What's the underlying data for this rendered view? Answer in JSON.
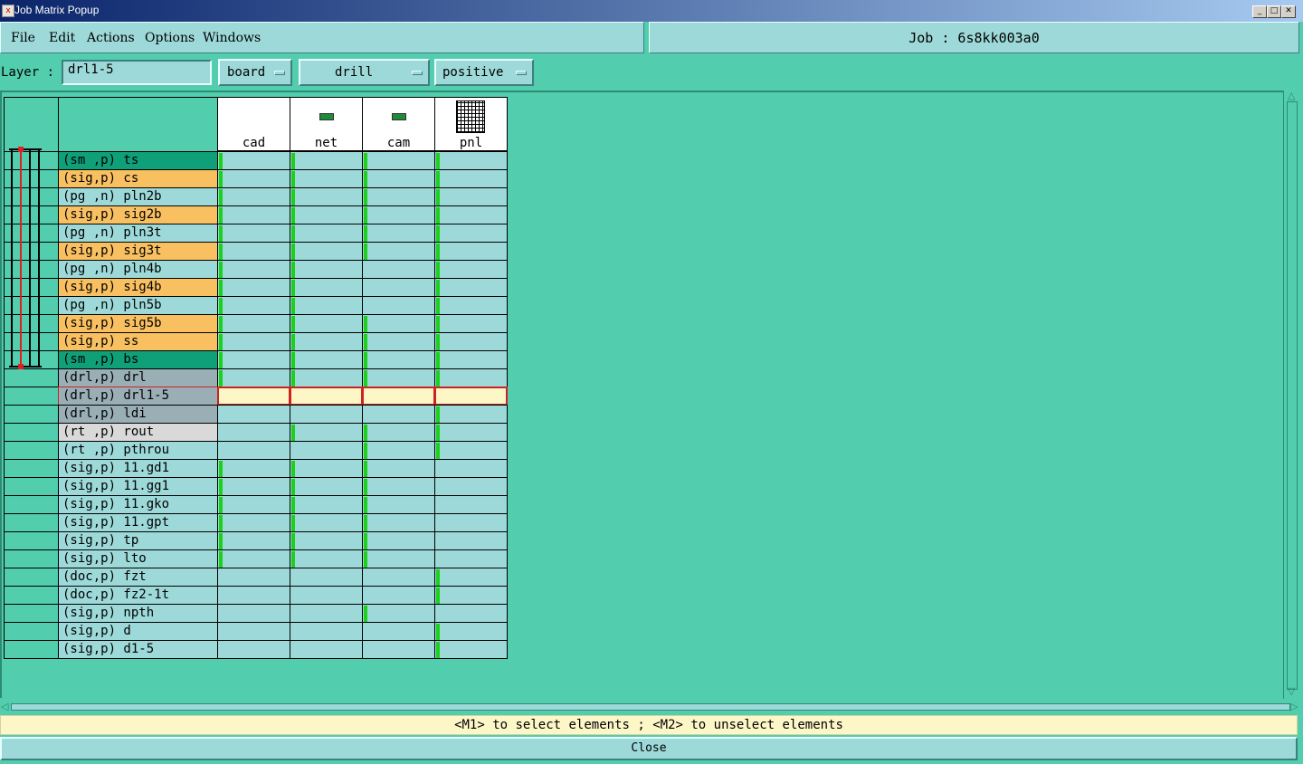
{
  "window": {
    "title": "Job Matrix Popup"
  },
  "menu": {
    "items": [
      "File",
      "Edit",
      "Actions",
      "Options",
      "Windows"
    ]
  },
  "job": {
    "label": "Job : 6s8kk003a0"
  },
  "layer_bar": {
    "label": "Layer :",
    "value": "drl1-5",
    "context": "board",
    "type": "drill",
    "polarity": "positive"
  },
  "matrix": {
    "columns": [
      {
        "name": "cad",
        "icon": "blank"
      },
      {
        "name": "net",
        "icon": "board-thumbnail-icon"
      },
      {
        "name": "cam",
        "icon": "board-thumbnail-icon"
      },
      {
        "name": "pnl",
        "icon": "panel-thumbnail-icon"
      }
    ],
    "rows": [
      {
        "label": "(sm ,p) ts",
        "color": "#0fa079",
        "exists": [
          1,
          1,
          1,
          1
        ]
      },
      {
        "label": "(sig,p) cs",
        "color": "#f8c061",
        "exists": [
          1,
          1,
          1,
          1
        ]
      },
      {
        "label": "(pg ,n) pln2b",
        "color": "#9ed9d9",
        "exists": [
          1,
          1,
          1,
          1
        ]
      },
      {
        "label": "(sig,p) sig2b",
        "color": "#f8c061",
        "exists": [
          1,
          1,
          1,
          1
        ]
      },
      {
        "label": "(pg ,n) pln3t",
        "color": "#9ed9d9",
        "exists": [
          1,
          1,
          1,
          1
        ]
      },
      {
        "label": "(sig,p) sig3t",
        "color": "#f8c061",
        "exists": [
          1,
          1,
          1,
          1
        ]
      },
      {
        "label": "(pg ,n) pln4b",
        "color": "#9ed9d9",
        "exists": [
          1,
          1,
          0,
          1
        ]
      },
      {
        "label": "(sig,p) sig4b",
        "color": "#f8c061",
        "exists": [
          1,
          1,
          0,
          1
        ]
      },
      {
        "label": "(pg ,n) pln5b",
        "color": "#9ed9d9",
        "exists": [
          1,
          1,
          0,
          1
        ]
      },
      {
        "label": "(sig,p) sig5b",
        "color": "#f8c061",
        "exists": [
          1,
          1,
          1,
          1
        ]
      },
      {
        "label": "(sig,p) ss",
        "color": "#f8c061",
        "exists": [
          1,
          1,
          1,
          1
        ]
      },
      {
        "label": "(sm ,p) bs",
        "color": "#0fa079",
        "exists": [
          1,
          1,
          1,
          1
        ]
      },
      {
        "label": "(drl,p) drl",
        "color": "#9aaeb6",
        "exists": [
          1,
          1,
          1,
          1
        ]
      },
      {
        "label": "(drl,p) drl1-5",
        "color": "#9aaeb6",
        "exists": [
          0,
          0,
          0,
          0
        ],
        "selected": true
      },
      {
        "label": "(drl,p) ldi",
        "color": "#9aaeb6",
        "exists": [
          0,
          0,
          0,
          1
        ]
      },
      {
        "label": "(rt ,p) rout",
        "color": "#d9d9d9",
        "exists": [
          0,
          1,
          1,
          1
        ]
      },
      {
        "label": "(rt ,p) pthrou",
        "color": "#9ed9d9",
        "exists": [
          0,
          0,
          1,
          1
        ]
      },
      {
        "label": "(sig,p) 11.gd1",
        "color": "#9ed9d9",
        "exists": [
          1,
          1,
          1,
          0
        ]
      },
      {
        "label": "(sig,p) 11.gg1",
        "color": "#9ed9d9",
        "exists": [
          1,
          1,
          1,
          0
        ]
      },
      {
        "label": "(sig,p) 11.gko",
        "color": "#9ed9d9",
        "exists": [
          1,
          1,
          1,
          0
        ]
      },
      {
        "label": "(sig,p) 11.gpt",
        "color": "#9ed9d9",
        "exists": [
          1,
          1,
          1,
          0
        ]
      },
      {
        "label": "(sig,p) tp",
        "color": "#9ed9d9",
        "exists": [
          1,
          1,
          1,
          0
        ]
      },
      {
        "label": "(sig,p) lto",
        "color": "#9ed9d9",
        "exists": [
          1,
          1,
          1,
          0
        ]
      },
      {
        "label": "(doc,p) fzt",
        "color": "#9ed9d9",
        "exists": [
          0,
          0,
          0,
          1
        ]
      },
      {
        "label": "(doc,p) fz2-1t",
        "color": "#9ed9d9",
        "exists": [
          0,
          0,
          0,
          1
        ]
      },
      {
        "label": "(sig,p) npth",
        "color": "#9ed9d9",
        "exists": [
          0,
          0,
          1,
          0
        ]
      },
      {
        "label": "(sig,p) d",
        "color": "#9ed9d9",
        "exists": [
          0,
          0,
          0,
          1
        ]
      },
      {
        "label": "(sig,p) d1-5",
        "color": "#9ed9d9",
        "exists": [
          0,
          0,
          0,
          1
        ]
      }
    ]
  },
  "status": {
    "text": "<M1> to select elements ; <M2> to unselect elements"
  },
  "footer": {
    "close_label": "Close"
  },
  "colors": {
    "background": "#52cdae",
    "panel": "#9ed9d9",
    "exists_marker": "#1ad21a",
    "selected_row": "#fdf7c8"
  }
}
